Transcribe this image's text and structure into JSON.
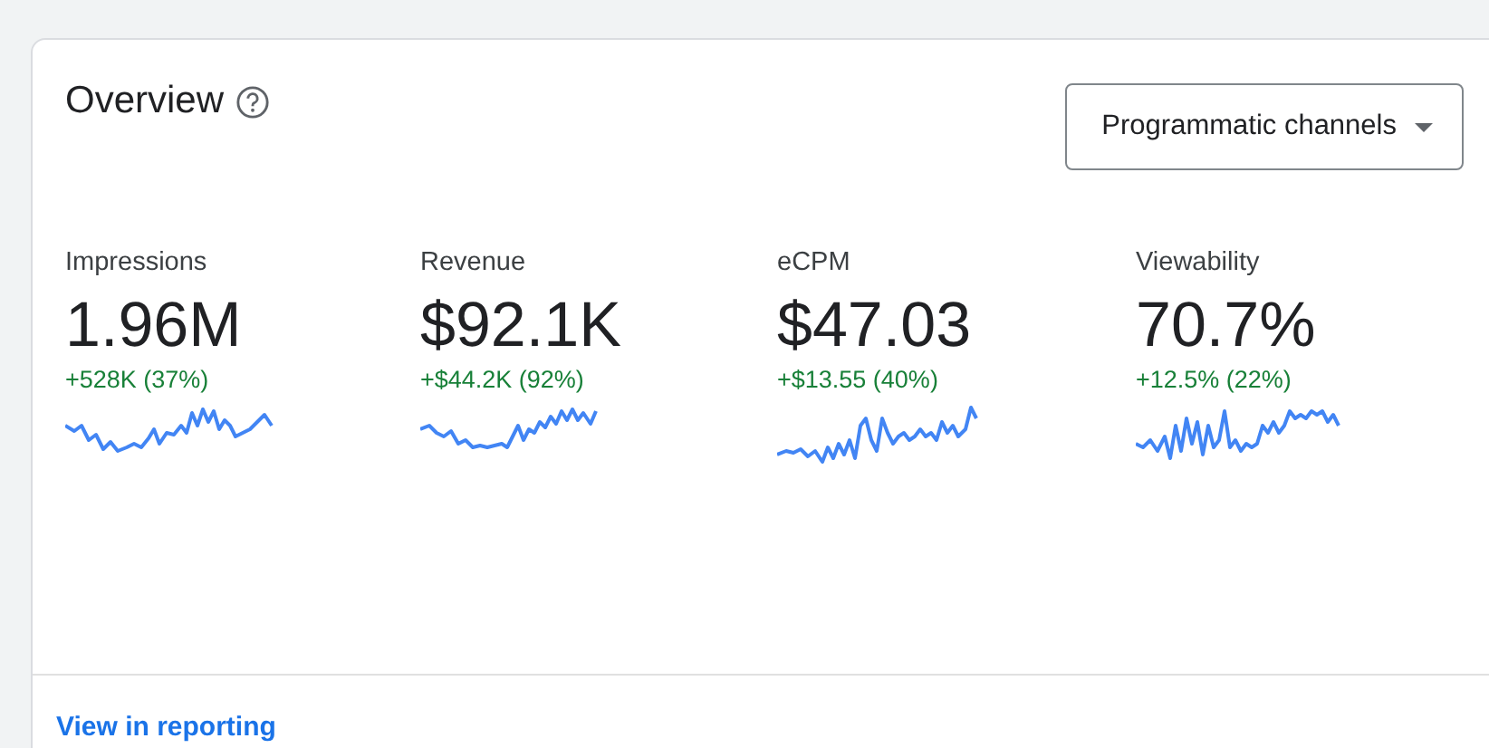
{
  "card": {
    "title": "Overview",
    "dropdown": {
      "label": "Programmatic channels"
    },
    "metrics": [
      {
        "label": "Impressions",
        "value": "1.96M",
        "change": "+528K (37%)"
      },
      {
        "label": "Revenue",
        "value": "$92.1K",
        "change": "+$44.2K (92%)"
      },
      {
        "label": "eCPM",
        "value": "$47.03",
        "change": "+$13.55 (40%)"
      },
      {
        "label": "Viewability",
        "value": "70.7%",
        "change": "+12.5% (22%)"
      }
    ],
    "link": "View in reporting"
  }
}
